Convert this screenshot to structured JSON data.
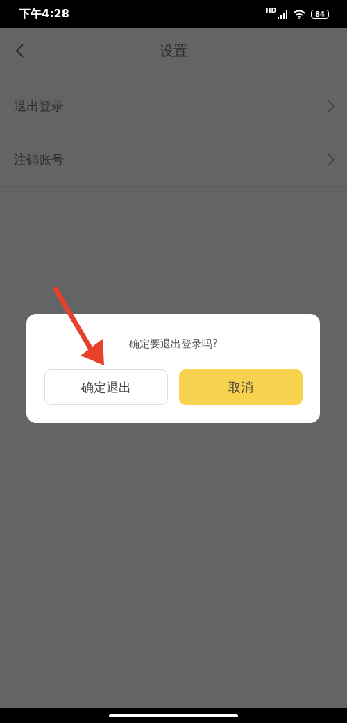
{
  "status_bar": {
    "time": "下午4:28",
    "network": "HD",
    "battery": "84"
  },
  "header": {
    "title": "设置"
  },
  "settings_items": [
    {
      "label": "退出登录"
    },
    {
      "label": "注销账号"
    }
  ],
  "dialog": {
    "message": "确定要退出登录吗?",
    "buttons": [
      {
        "label": "确定退出",
        "kind": "secondary"
      },
      {
        "label": "取消",
        "kind": "primary"
      }
    ]
  }
}
